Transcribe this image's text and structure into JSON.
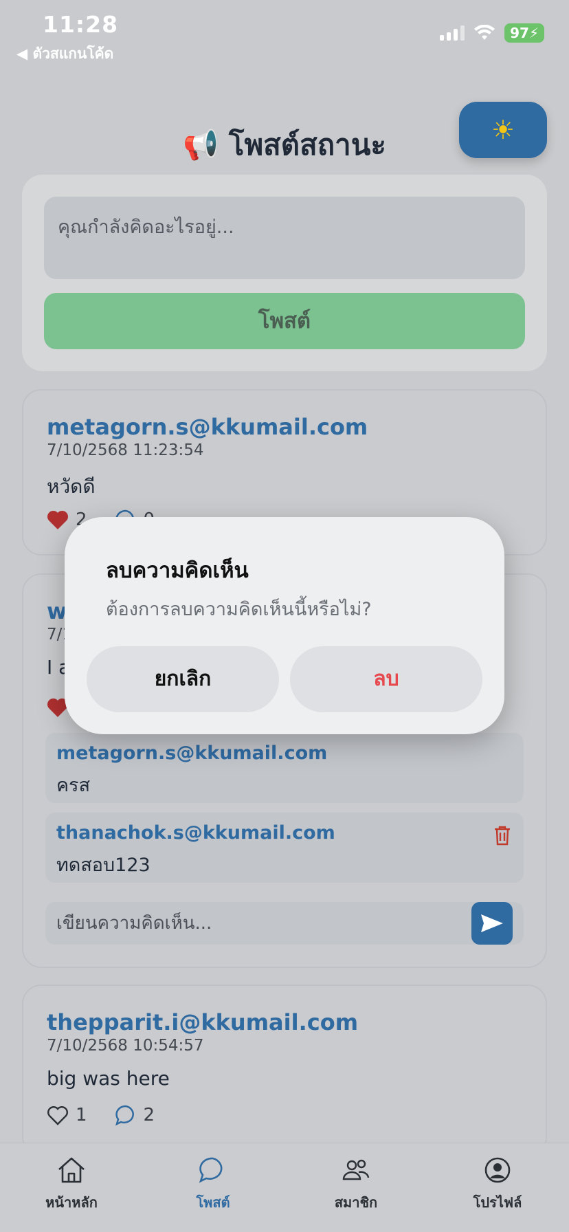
{
  "status_bar": {
    "time": "11:28",
    "back_app": "◀ ตัวสแกนโค้ด",
    "battery": "97"
  },
  "header": {
    "title": "📢 โพสต์สถานะ",
    "theme_icon": "sun-icon"
  },
  "composer": {
    "placeholder": "คุณกำลังคิดอะไรอยู่...",
    "post_label": "โพสต์"
  },
  "posts": [
    {
      "author": "metagorn.s@kkumail.com",
      "date": "7/10/2568 11:23:54",
      "text": "หวัดดี",
      "likes": "2",
      "comments": "0"
    },
    {
      "author": "w",
      "date": "7/1",
      "text": "I a",
      "comment_list": [
        {
          "author": "metagorn.s@kkumail.com",
          "text": "ครส"
        },
        {
          "author": "thanachok.s@kkumail.com",
          "text": "ทดสอบ123"
        }
      ],
      "comment_placeholder": "เขียนความคิดเห็น..."
    },
    {
      "author": "thepparit.i@kkumail.com",
      "date": "7/10/2568 10:54:57",
      "text": "big was here",
      "likes": "1",
      "comments": "2"
    }
  ],
  "dialog": {
    "title": "ลบความคิดเห็น",
    "message": "ต้องการลบความคิดเห็นนี้หรือไม่?",
    "cancel": "ยกเลิก",
    "confirm": "ลบ"
  },
  "nav": [
    {
      "label": "หน้าหลัก",
      "icon": "home-icon"
    },
    {
      "label": "โพสต์",
      "icon": "chat-icon"
    },
    {
      "label": "สมาชิก",
      "icon": "members-icon"
    },
    {
      "label": "โปรไฟล์",
      "icon": "profile-icon"
    }
  ],
  "colors": {
    "accent": "#2f6aa1",
    "post_button": "#7cc190",
    "delete": "#e5484d",
    "heart": "#b03030"
  }
}
